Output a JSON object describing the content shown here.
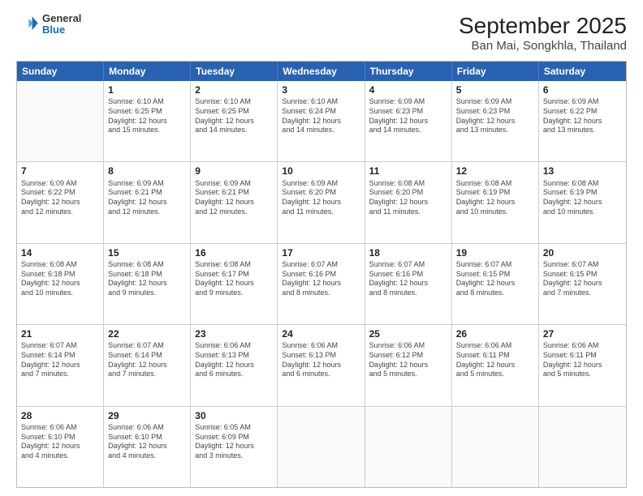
{
  "logo": {
    "line1": "General",
    "line2": "Blue"
  },
  "title": "September 2025",
  "subtitle": "Ban Mai, Songkhla, Thailand",
  "weekdays": [
    "Sunday",
    "Monday",
    "Tuesday",
    "Wednesday",
    "Thursday",
    "Friday",
    "Saturday"
  ],
  "weeks": [
    [
      {
        "day": "",
        "info": ""
      },
      {
        "day": "1",
        "info": "Sunrise: 6:10 AM\nSunset: 6:25 PM\nDaylight: 12 hours\nand 15 minutes."
      },
      {
        "day": "2",
        "info": "Sunrise: 6:10 AM\nSunset: 6:25 PM\nDaylight: 12 hours\nand 14 minutes."
      },
      {
        "day": "3",
        "info": "Sunrise: 6:10 AM\nSunset: 6:24 PM\nDaylight: 12 hours\nand 14 minutes."
      },
      {
        "day": "4",
        "info": "Sunrise: 6:09 AM\nSunset: 6:23 PM\nDaylight: 12 hours\nand 14 minutes."
      },
      {
        "day": "5",
        "info": "Sunrise: 6:09 AM\nSunset: 6:23 PM\nDaylight: 12 hours\nand 13 minutes."
      },
      {
        "day": "6",
        "info": "Sunrise: 6:09 AM\nSunset: 6:22 PM\nDaylight: 12 hours\nand 13 minutes."
      }
    ],
    [
      {
        "day": "7",
        "info": "Sunrise: 6:09 AM\nSunset: 6:22 PM\nDaylight: 12 hours\nand 12 minutes."
      },
      {
        "day": "8",
        "info": "Sunrise: 6:09 AM\nSunset: 6:21 PM\nDaylight: 12 hours\nand 12 minutes."
      },
      {
        "day": "9",
        "info": "Sunrise: 6:09 AM\nSunset: 6:21 PM\nDaylight: 12 hours\nand 12 minutes."
      },
      {
        "day": "10",
        "info": "Sunrise: 6:09 AM\nSunset: 6:20 PM\nDaylight: 12 hours\nand 11 minutes."
      },
      {
        "day": "11",
        "info": "Sunrise: 6:08 AM\nSunset: 6:20 PM\nDaylight: 12 hours\nand 11 minutes."
      },
      {
        "day": "12",
        "info": "Sunrise: 6:08 AM\nSunset: 6:19 PM\nDaylight: 12 hours\nand 10 minutes."
      },
      {
        "day": "13",
        "info": "Sunrise: 6:08 AM\nSunset: 6:19 PM\nDaylight: 12 hours\nand 10 minutes."
      }
    ],
    [
      {
        "day": "14",
        "info": "Sunrise: 6:08 AM\nSunset: 6:18 PM\nDaylight: 12 hours\nand 10 minutes."
      },
      {
        "day": "15",
        "info": "Sunrise: 6:08 AM\nSunset: 6:18 PM\nDaylight: 12 hours\nand 9 minutes."
      },
      {
        "day": "16",
        "info": "Sunrise: 6:08 AM\nSunset: 6:17 PM\nDaylight: 12 hours\nand 9 minutes."
      },
      {
        "day": "17",
        "info": "Sunrise: 6:07 AM\nSunset: 6:16 PM\nDaylight: 12 hours\nand 8 minutes."
      },
      {
        "day": "18",
        "info": "Sunrise: 6:07 AM\nSunset: 6:16 PM\nDaylight: 12 hours\nand 8 minutes."
      },
      {
        "day": "19",
        "info": "Sunrise: 6:07 AM\nSunset: 6:15 PM\nDaylight: 12 hours\nand 8 minutes."
      },
      {
        "day": "20",
        "info": "Sunrise: 6:07 AM\nSunset: 6:15 PM\nDaylight: 12 hours\nand 7 minutes."
      }
    ],
    [
      {
        "day": "21",
        "info": "Sunrise: 6:07 AM\nSunset: 6:14 PM\nDaylight: 12 hours\nand 7 minutes."
      },
      {
        "day": "22",
        "info": "Sunrise: 6:07 AM\nSunset: 6:14 PM\nDaylight: 12 hours\nand 7 minutes."
      },
      {
        "day": "23",
        "info": "Sunrise: 6:06 AM\nSunset: 6:13 PM\nDaylight: 12 hours\nand 6 minutes."
      },
      {
        "day": "24",
        "info": "Sunrise: 6:06 AM\nSunset: 6:13 PM\nDaylight: 12 hours\nand 6 minutes."
      },
      {
        "day": "25",
        "info": "Sunrise: 6:06 AM\nSunset: 6:12 PM\nDaylight: 12 hours\nand 5 minutes."
      },
      {
        "day": "26",
        "info": "Sunrise: 6:06 AM\nSunset: 6:11 PM\nDaylight: 12 hours\nand 5 minutes."
      },
      {
        "day": "27",
        "info": "Sunrise: 6:06 AM\nSunset: 6:11 PM\nDaylight: 12 hours\nand 5 minutes."
      }
    ],
    [
      {
        "day": "28",
        "info": "Sunrise: 6:06 AM\nSunset: 6:10 PM\nDaylight: 12 hours\nand 4 minutes."
      },
      {
        "day": "29",
        "info": "Sunrise: 6:06 AM\nSunset: 6:10 PM\nDaylight: 12 hours\nand 4 minutes."
      },
      {
        "day": "30",
        "info": "Sunrise: 6:05 AM\nSunset: 6:09 PM\nDaylight: 12 hours\nand 3 minutes."
      },
      {
        "day": "",
        "info": ""
      },
      {
        "day": "",
        "info": ""
      },
      {
        "day": "",
        "info": ""
      },
      {
        "day": "",
        "info": ""
      }
    ]
  ]
}
